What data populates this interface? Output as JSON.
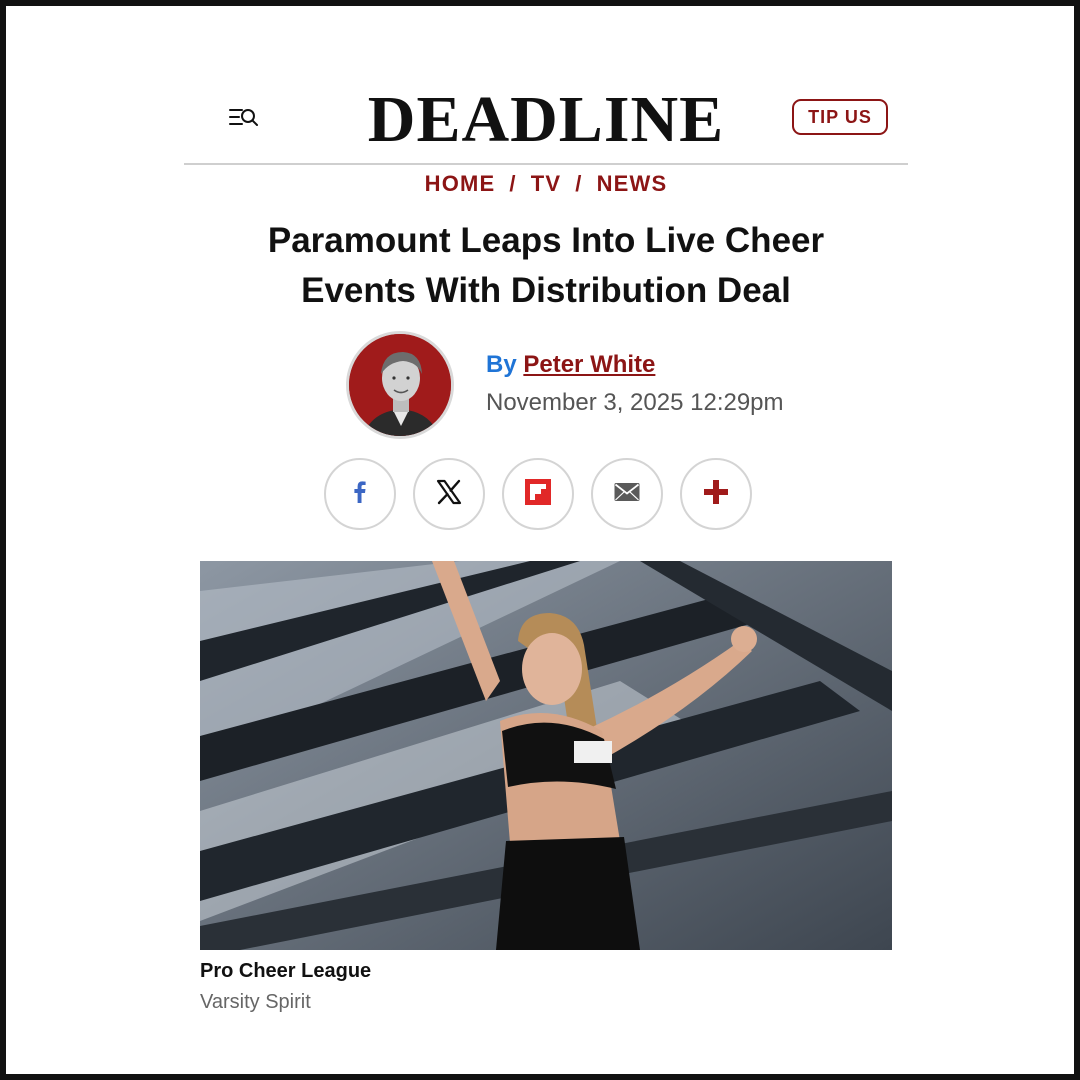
{
  "header": {
    "logo_text": "DEADLINE",
    "tip_label": "TIP US",
    "menu_icon": "menu-search-icon"
  },
  "breadcrumb": [
    {
      "label": "HOME"
    },
    {
      "label": "TV"
    },
    {
      "label": "NEWS"
    }
  ],
  "breadcrumb_separator": "/",
  "article": {
    "headline_line1": "Paramount Leaps Into Live Cheer",
    "headline_line2": "Events With Distribution Deal",
    "by_label": "By",
    "author": "Peter White",
    "date": "November 3, 2025 12:29pm"
  },
  "share": [
    {
      "icon": "facebook-icon"
    },
    {
      "icon": "x-icon"
    },
    {
      "icon": "flipboard-icon"
    },
    {
      "icon": "email-icon"
    },
    {
      "icon": "plus-icon"
    }
  ],
  "image": {
    "caption": "Pro Cheer League",
    "credit": "Varsity Spirit"
  },
  "colors": {
    "accent": "#8c1515",
    "by_blue": "#1f74d6",
    "facebook": "#3b66c4",
    "flipboard": "#e12828",
    "avatar_bg": "#a01b1b"
  }
}
